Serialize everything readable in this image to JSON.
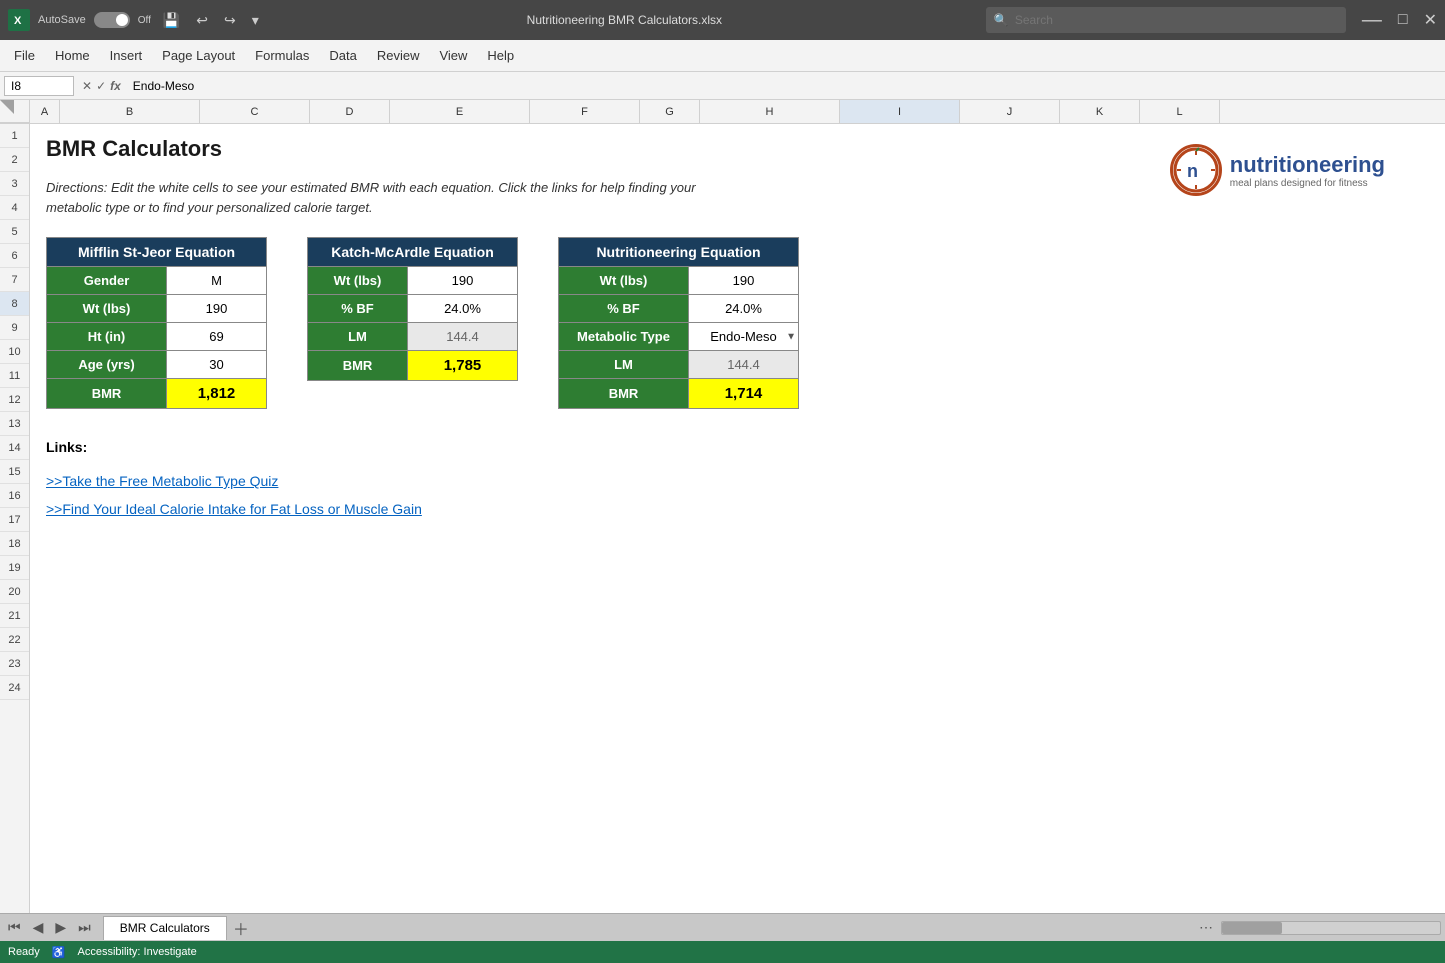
{
  "titlebar": {
    "excel_icon": "X",
    "autosave": "AutoSave",
    "toggle_state": "Off",
    "file_name": "Nutritioneering BMR Calculators.xlsx",
    "search_placeholder": "Search"
  },
  "ribbon": {
    "items": [
      "File",
      "Home",
      "Insert",
      "Page Layout",
      "Formulas",
      "Data",
      "Review",
      "View",
      "Help"
    ]
  },
  "formula_bar": {
    "cell_ref": "I8",
    "formula_value": "Endo-Meso"
  },
  "sheet": {
    "title": "BMR Calculators",
    "directions": "Directions: Edit the white cells to see your estimated BMR with each equation. Click the links for help finding your metabolic type or to find your personalized calorie target.",
    "logo_brand": "nutritioneering",
    "logo_tagline": "meal plans designed for fitness",
    "mifflin": {
      "header": "Mifflin St-Jeor Equation",
      "rows": [
        {
          "label": "Gender",
          "value": "M"
        },
        {
          "label": "Wt (lbs)",
          "value": "190"
        },
        {
          "label": "Ht (in)",
          "value": "69"
        },
        {
          "label": "Age (yrs)",
          "value": "30"
        },
        {
          "label": "BMR",
          "value": "1,812"
        }
      ]
    },
    "katch": {
      "header": "Katch-McArdle Equation",
      "rows": [
        {
          "label": "Wt (lbs)",
          "value": "190"
        },
        {
          "label": "% BF",
          "value": "24.0%"
        },
        {
          "label": "LM",
          "value": "144.4",
          "gray": true
        },
        {
          "label": "BMR",
          "value": "1,785"
        }
      ]
    },
    "nutritioneering": {
      "header": "Nutritioneering Equation",
      "rows": [
        {
          "label": "Wt (lbs)",
          "value": "190"
        },
        {
          "label": "% BF",
          "value": "24.0%"
        },
        {
          "label": "Metabolic Type",
          "value": "Endo-Meso",
          "dropdown": true
        },
        {
          "label": "LM",
          "value": "144.4",
          "gray": true
        },
        {
          "label": "BMR",
          "value": "1,714"
        }
      ]
    },
    "links_title": "Links:",
    "links": [
      ">>Take the Free Metabolic Type Quiz",
      ">>Find Your Ideal Calorie Intake for Fat Loss or Muscle Gain"
    ]
  },
  "columns": [
    "A",
    "B",
    "C",
    "D",
    "E",
    "F",
    "G",
    "H",
    "I",
    "J",
    "K",
    "L"
  ],
  "rows": [
    1,
    2,
    3,
    4,
    5,
    6,
    7,
    8,
    9,
    10,
    11,
    12,
    13,
    14,
    15,
    16,
    17,
    18,
    19,
    20,
    21,
    22,
    23,
    24
  ],
  "tab": {
    "sheet_name": "BMR Calculators"
  },
  "statusbar": {
    "ready": "Ready",
    "accessibility": "Accessibility: Investigate"
  }
}
